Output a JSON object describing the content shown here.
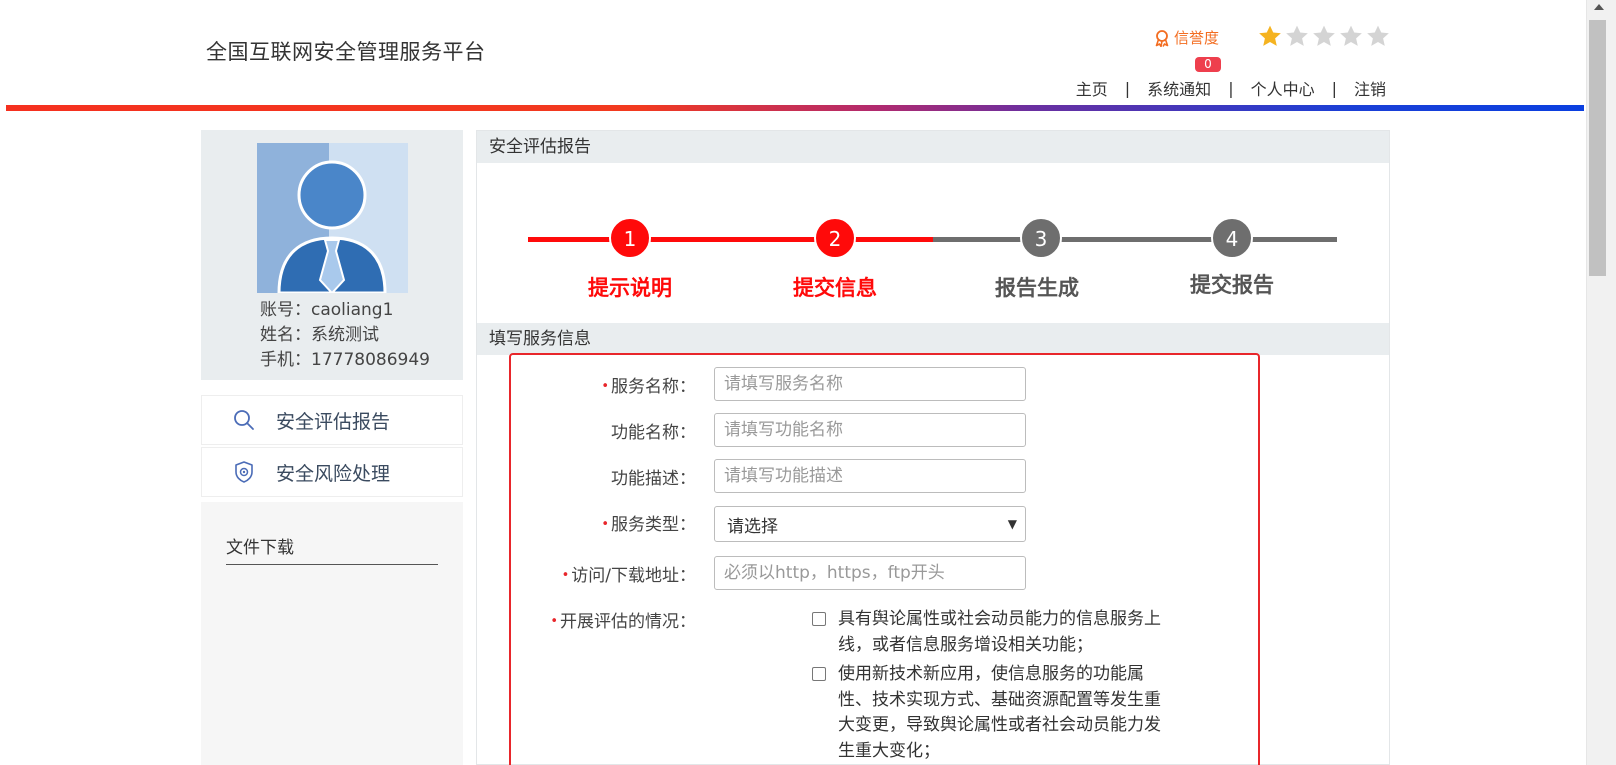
{
  "header": {
    "site_title": "全国互联网安全管理服务平台",
    "credit_label": "信誉度",
    "credit_badge": "0",
    "stars_filled": 1,
    "stars_total": 5,
    "nav": [
      {
        "label": "主页"
      },
      {
        "label": "系统通知"
      },
      {
        "label": "个人中心"
      },
      {
        "label": "注销"
      }
    ],
    "nav_separator": "|"
  },
  "sidebar": {
    "account": "账号：caoliang1",
    "name": "姓名：系统测试",
    "phone": "手机：17778086949",
    "menu": [
      {
        "label": "安全评估报告",
        "icon": "search-icon"
      },
      {
        "label": "安全风险处理",
        "icon": "shield-icon"
      }
    ],
    "download_title": "文件下载"
  },
  "main": {
    "report_title": "安全评估报告",
    "steps": [
      {
        "number": "1",
        "label": "提示说明",
        "state": "done"
      },
      {
        "number": "2",
        "label": "提交信息",
        "state": "active"
      },
      {
        "number": "3",
        "label": "报告生成",
        "state": "pending"
      },
      {
        "number": "4",
        "label": "提交报告",
        "state": "pending"
      }
    ],
    "form_section_title": "填写服务信息",
    "required_mark": "•",
    "fields": {
      "service_name": {
        "label": "服务名称：",
        "placeholder": "请填写服务名称",
        "required": true
      },
      "function_name": {
        "label": "功能名称：",
        "placeholder": "请填写功能名称",
        "required": false
      },
      "function_desc": {
        "label": "功能描述：",
        "placeholder": "请填写功能描述",
        "required": false
      },
      "service_type": {
        "label": "服务类型：",
        "value": "请选择",
        "required": true
      },
      "access_url": {
        "label": "访问/下载地址：",
        "placeholder": "必须以http，https，ftp开头",
        "required": true
      },
      "assessment": {
        "label": "开展评估的情况：",
        "required": true
      }
    },
    "checkbox_options": [
      {
        "text": "具有舆论属性或社会动员能力的信息服务上线，或者信息服务增设相关功能；"
      },
      {
        "text": "使用新技术新应用，使信息服务的功能属性、技术实现方式、基础资源配置等发生重大变更，导致舆论属性或者社会动员能力发生重大变化；"
      }
    ]
  },
  "colors": {
    "accent_red": "#ff0a0a",
    "pending_gray": "#6e6e6e",
    "credit_orange": "#f36d21",
    "star_gold": "#f5b320",
    "star_gray": "#d4d4d4"
  }
}
